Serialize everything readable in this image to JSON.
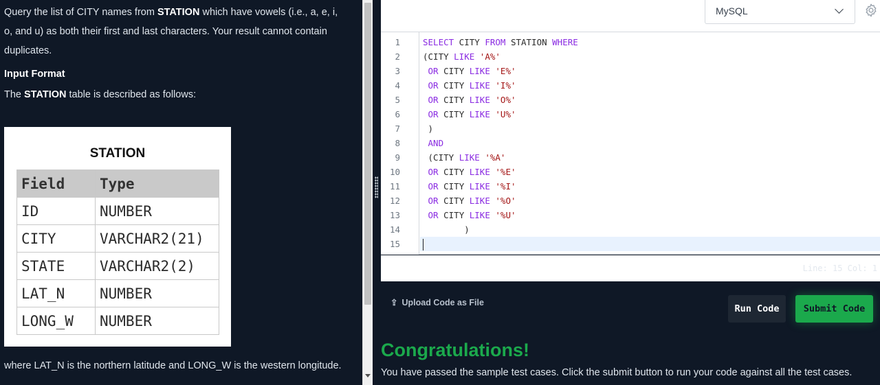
{
  "problem": {
    "intro_prefix": "Query the list of CITY names from ",
    "intro_station": "STATION",
    "intro_suffix": " which have vowels (i.e., a, e, i, o, and u) as both their first and last characters. Your result cannot contain duplicates.",
    "input_format_heading": "Input Format",
    "table_desc_prefix": "The ",
    "table_desc_station": "STATION",
    "table_desc_suffix": " table is described as follows:",
    "footnote": "where LAT_N is the northern latitude and LONG_W is the western longitude."
  },
  "station_table": {
    "title": "STATION",
    "headers": [
      "Field",
      "Type"
    ],
    "rows": [
      [
        "ID",
        "NUMBER"
      ],
      [
        "CITY",
        "VARCHAR2(21)"
      ],
      [
        "STATE",
        "VARCHAR2(2)"
      ],
      [
        "LAT_N",
        "NUMBER"
      ],
      [
        "LONG_W",
        "NUMBER"
      ]
    ]
  },
  "editor": {
    "language": "MySQL",
    "status": "Line: 15 Col: 1",
    "line_numbers": [
      "1",
      "2",
      "3",
      "4",
      "5",
      "6",
      "7",
      "8",
      "9",
      "10",
      "11",
      "12",
      "13",
      "14",
      "15"
    ],
    "lines": [
      [
        {
          "t": "SELECT",
          "c": "kw"
        },
        {
          "t": " CITY ",
          "c": ""
        },
        {
          "t": "FROM",
          "c": "kw"
        },
        {
          "t": " STATION ",
          "c": ""
        },
        {
          "t": "WHERE",
          "c": "kw"
        }
      ],
      [
        {
          "t": "(CITY ",
          "c": ""
        },
        {
          "t": "LIKE",
          "c": "kw"
        },
        {
          "t": " ",
          "c": ""
        },
        {
          "t": "'A%'",
          "c": "str"
        }
      ],
      [
        {
          "t": " ",
          "c": ""
        },
        {
          "t": "OR",
          "c": "kw"
        },
        {
          "t": " CITY ",
          "c": ""
        },
        {
          "t": "LIKE",
          "c": "kw"
        },
        {
          "t": " ",
          "c": ""
        },
        {
          "t": "'E%'",
          "c": "str"
        }
      ],
      [
        {
          "t": " ",
          "c": ""
        },
        {
          "t": "OR",
          "c": "kw"
        },
        {
          "t": " CITY ",
          "c": ""
        },
        {
          "t": "LIKE",
          "c": "kw"
        },
        {
          "t": " ",
          "c": ""
        },
        {
          "t": "'I%'",
          "c": "str"
        }
      ],
      [
        {
          "t": " ",
          "c": ""
        },
        {
          "t": "OR",
          "c": "kw"
        },
        {
          "t": " CITY ",
          "c": ""
        },
        {
          "t": "LIKE",
          "c": "kw"
        },
        {
          "t": " ",
          "c": ""
        },
        {
          "t": "'O%'",
          "c": "str"
        }
      ],
      [
        {
          "t": " ",
          "c": ""
        },
        {
          "t": "OR",
          "c": "kw"
        },
        {
          "t": " CITY ",
          "c": ""
        },
        {
          "t": "LIKE",
          "c": "kw"
        },
        {
          "t": " ",
          "c": ""
        },
        {
          "t": "'U%'",
          "c": "str"
        }
      ],
      [
        {
          "t": " )",
          "c": ""
        }
      ],
      [
        {
          "t": " ",
          "c": ""
        },
        {
          "t": "AND",
          "c": "kw"
        }
      ],
      [
        {
          "t": " (CITY ",
          "c": ""
        },
        {
          "t": "LIKE",
          "c": "kw"
        },
        {
          "t": " ",
          "c": ""
        },
        {
          "t": "'%A'",
          "c": "str"
        }
      ],
      [
        {
          "t": " ",
          "c": ""
        },
        {
          "t": "OR",
          "c": "kw"
        },
        {
          "t": " CITY ",
          "c": ""
        },
        {
          "t": "LIKE",
          "c": "kw"
        },
        {
          "t": " ",
          "c": ""
        },
        {
          "t": "'%E'",
          "c": "str"
        }
      ],
      [
        {
          "t": " ",
          "c": ""
        },
        {
          "t": "OR",
          "c": "kw"
        },
        {
          "t": " CITY ",
          "c": ""
        },
        {
          "t": "LIKE",
          "c": "kw"
        },
        {
          "t": " ",
          "c": ""
        },
        {
          "t": "'%I'",
          "c": "str"
        }
      ],
      [
        {
          "t": " ",
          "c": ""
        },
        {
          "t": "OR",
          "c": "kw"
        },
        {
          "t": " CITY ",
          "c": ""
        },
        {
          "t": "LIKE",
          "c": "kw"
        },
        {
          "t": " ",
          "c": ""
        },
        {
          "t": "'%O'",
          "c": "str"
        }
      ],
      [
        {
          "t": " ",
          "c": ""
        },
        {
          "t": "OR",
          "c": "kw"
        },
        {
          "t": " CITY ",
          "c": ""
        },
        {
          "t": "LIKE",
          "c": "kw"
        },
        {
          "t": " ",
          "c": ""
        },
        {
          "t": "'%U'",
          "c": "str"
        }
      ],
      [
        {
          "t": "        )",
          "c": ""
        }
      ],
      []
    ]
  },
  "actions": {
    "upload_label": "Upload Code as File",
    "run_label": "Run Code",
    "submit_label": "Submit Code"
  },
  "result": {
    "title": "Congratulations!",
    "message": "You have passed the sample test cases. Click the submit button to run your code against all the test cases."
  },
  "icons": {
    "upload": "upload-icon",
    "settings": "gear-icon",
    "dropdown": "chevron-down-icon"
  },
  "colors": {
    "page_bg": "#0f1826",
    "accent_green": "#1ba94c",
    "keyword": "#8a2be2",
    "string": "#a31515"
  }
}
